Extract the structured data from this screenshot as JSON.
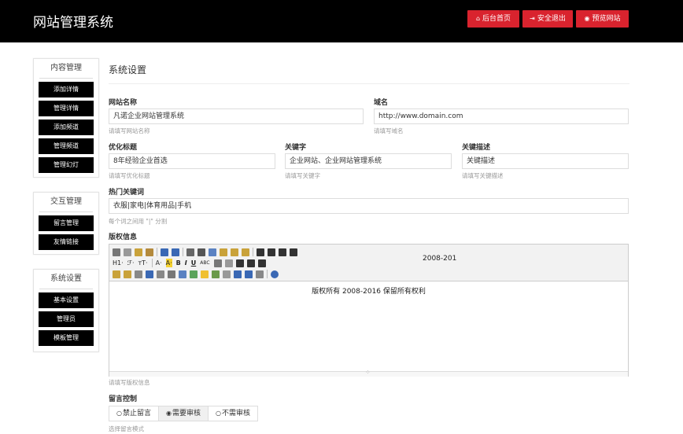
{
  "header": {
    "brand": "网站管理系统",
    "buttons": [
      {
        "label": "后台首页",
        "icon": "home-icon"
      },
      {
        "label": "安全退出",
        "icon": "logout-icon"
      },
      {
        "label": "预览网站",
        "icon": "eye-icon"
      }
    ],
    "accent": "#d9232e"
  },
  "sidebar": {
    "groups": [
      {
        "title": "内容管理",
        "items": [
          "添加详情",
          "管理详情",
          "添加频道",
          "管理频道",
          "管理幻灯"
        ]
      },
      {
        "title": "交互管理",
        "items": [
          "留言管理",
          "友情链接"
        ]
      },
      {
        "title": "系统设置",
        "items": [
          "基本设置",
          "管理员",
          "模板管理"
        ]
      }
    ]
  },
  "main": {
    "title": "系统设置",
    "site_name": {
      "label": "网站名称",
      "value": "凡诺企业网站管理系统",
      "help": "请填写网站名称"
    },
    "domain": {
      "label": "域名",
      "value": "http://www.domain.com",
      "help": "请填写域名"
    },
    "seo_title": {
      "label": "优化标题",
      "value": "8年经验企业首选",
      "help": "请填写优化标题"
    },
    "keywords": {
      "label": "关键字",
      "value": "企业网站、企业网站管理系统",
      "help": "请填写关键字"
    },
    "description": {
      "label": "关键描述",
      "value": "关键描述",
      "help": "请填写关键描述"
    },
    "hot_keywords": {
      "label": "热门关键词",
      "value": "衣服|家电|体育用品|手机",
      "help": "每个词之间用 \"|\" 分割"
    },
    "copyright": {
      "label": "版权信息",
      "toolbar": {
        "heading": "H1·",
        "font": "ℱ·",
        "size": "тT·",
        "popup": "2008-201"
      },
      "content": "版权所有 2008-2016 保留所有权利",
      "help": "请填写版权信息"
    },
    "guestbook": {
      "label": "留言控制",
      "options": [
        "禁止留言",
        "需要审核",
        "不需审核"
      ],
      "selected": "需要审核",
      "help": "选择留言模式"
    }
  }
}
